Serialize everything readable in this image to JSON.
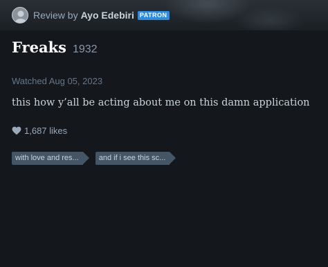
{
  "review": {
    "prefix": "Review by",
    "reviewer": "Ayo Edebiri",
    "badge": "PATRON",
    "film_title": "Freaks",
    "film_year": "1932",
    "watched": "Watched Aug 05, 2023",
    "body": "this how y’all be acting about me on this damn application",
    "likes": "1,687 likes",
    "tags": [
      "with love and res...",
      "and if i see this sc..."
    ]
  },
  "icons": {
    "avatar": "avatar-silhouette-icon",
    "likes": "heart-icon"
  },
  "colors": {
    "background": "#14181c",
    "badge": "#2a8de0",
    "tag": "#445566",
    "text_primary": "#ffffff",
    "text_secondary": "#99aabb"
  }
}
